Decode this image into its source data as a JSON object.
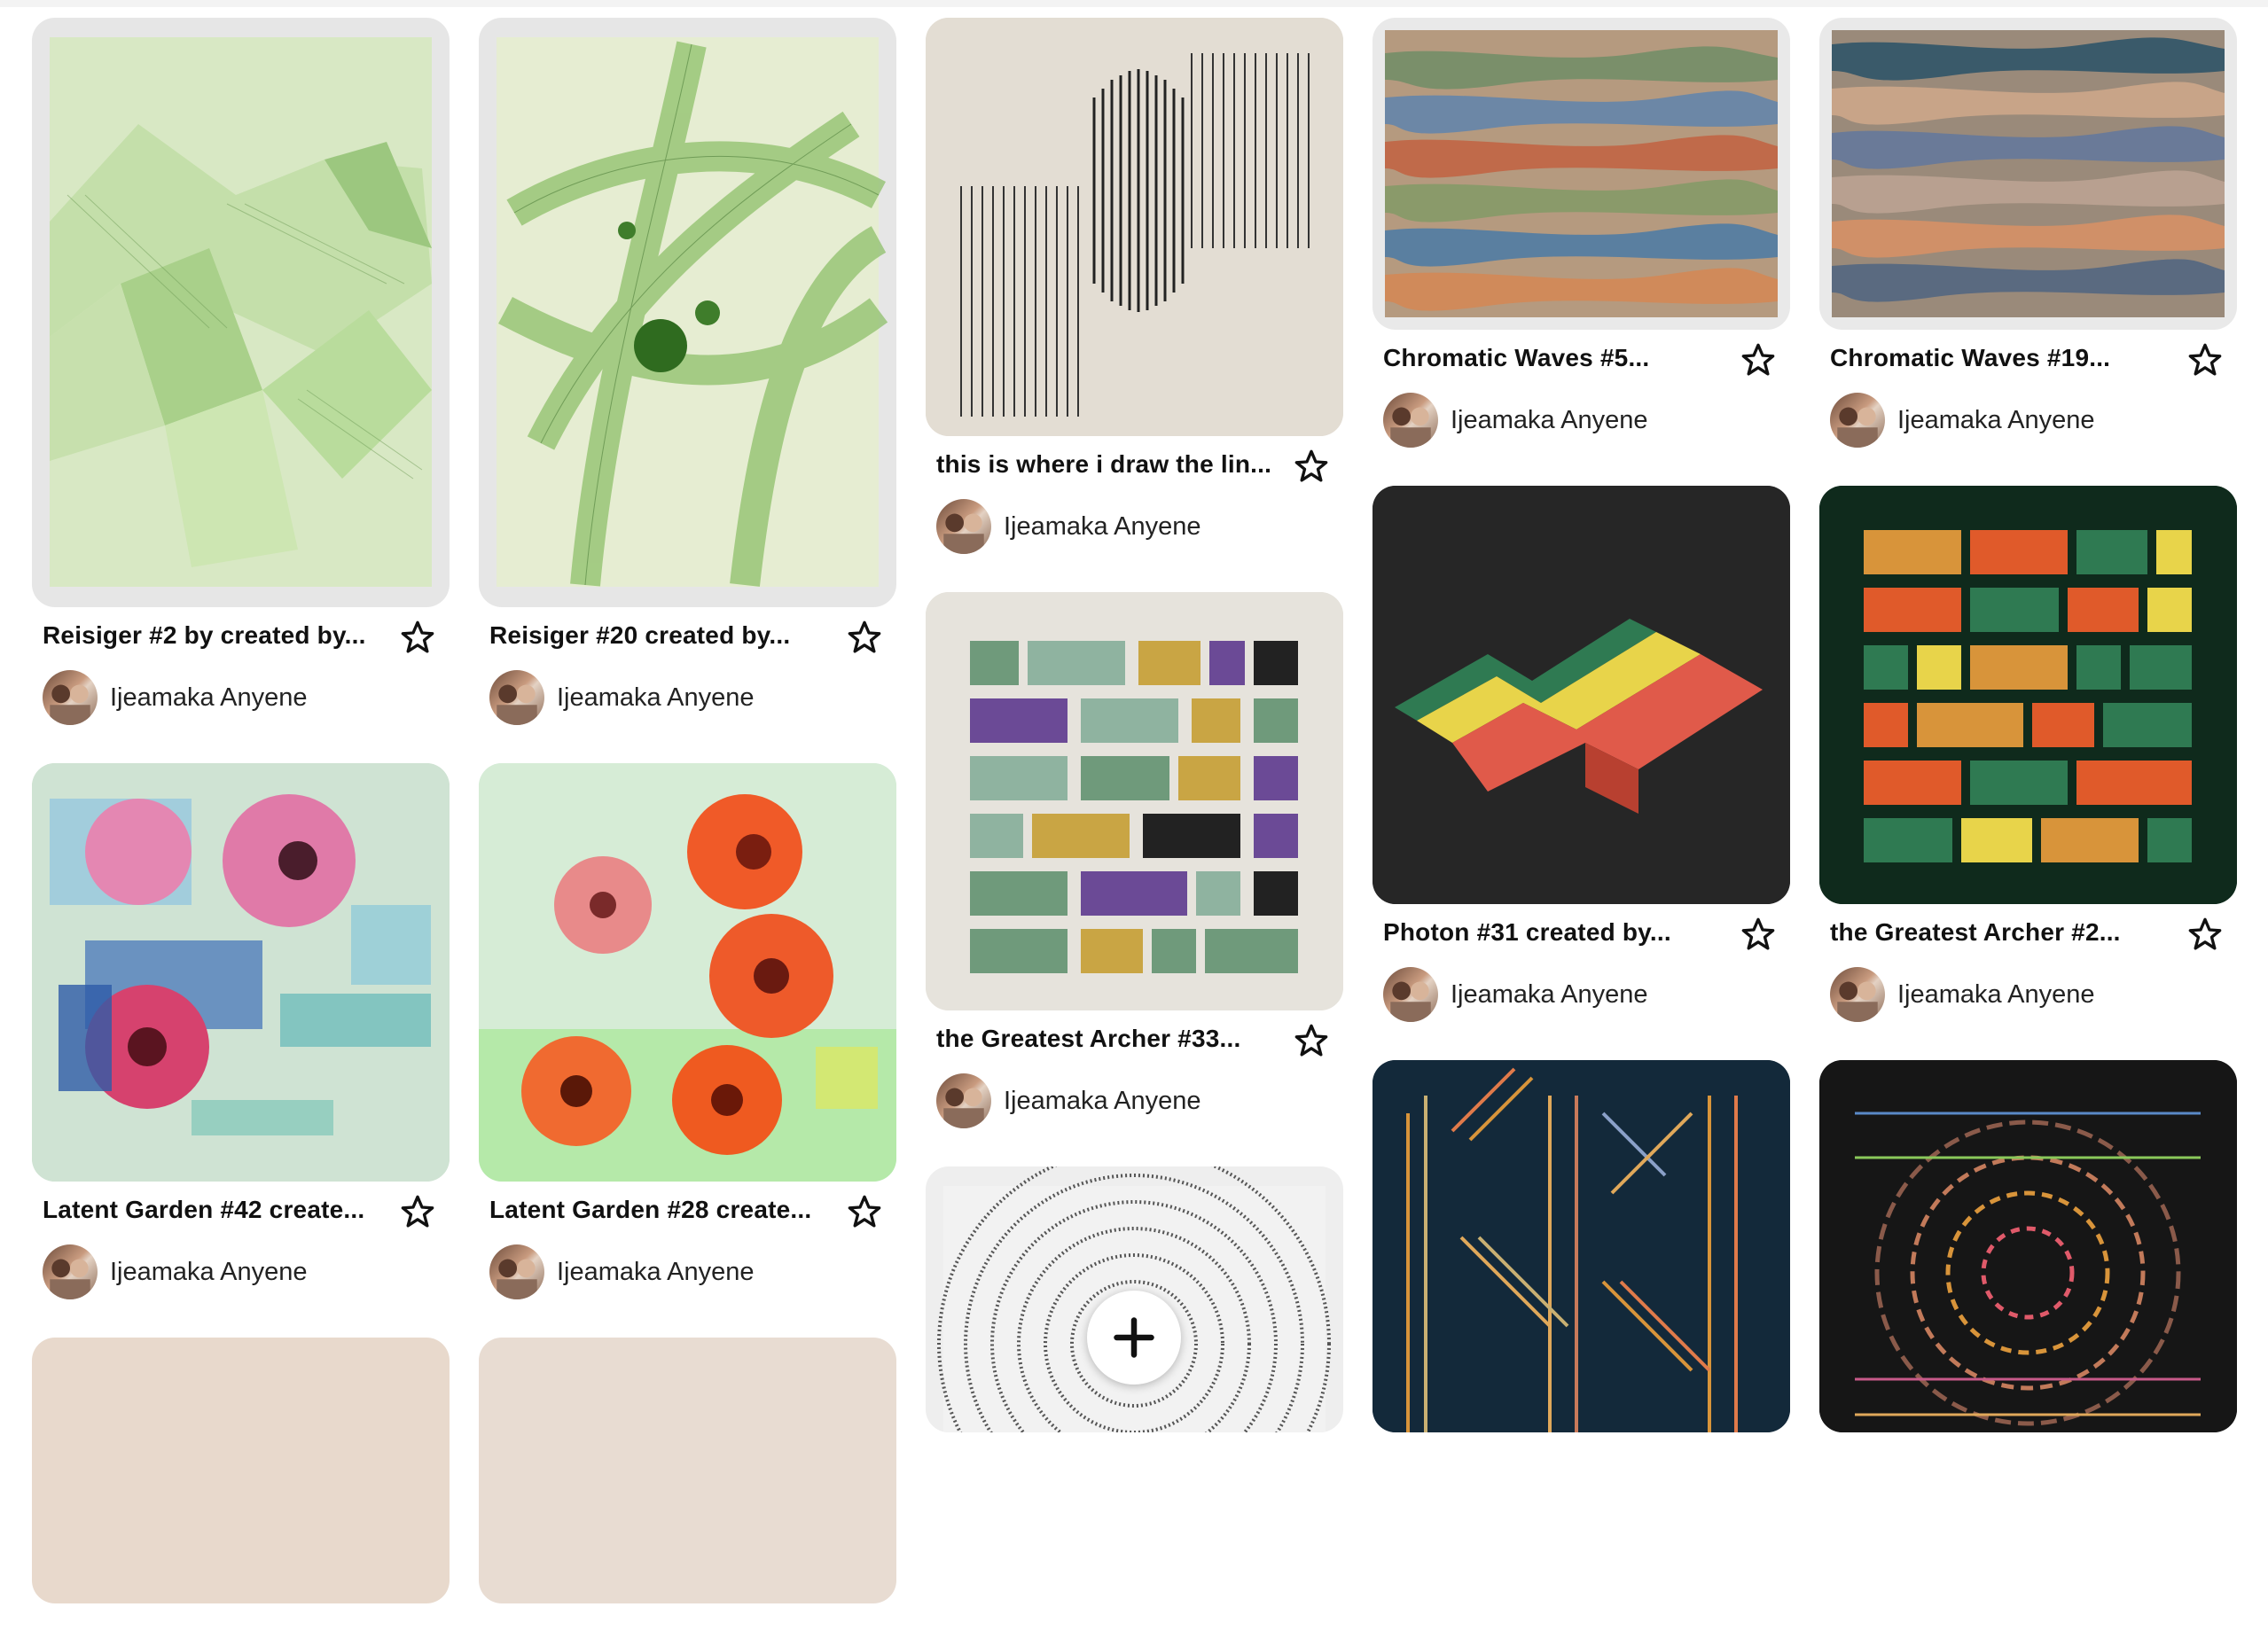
{
  "pins": [
    {
      "title": "Reisiger #2 by created by...",
      "author": "Ijeamaka Anyene"
    },
    {
      "title": "Latent Garden #42 create...",
      "author": "Ijeamaka Anyene"
    },
    {
      "title": "Reisiger #20 created by...",
      "author": "Ijeamaka Anyene"
    },
    {
      "title": "Latent Garden #28 create...",
      "author": "Ijeamaka Anyene"
    },
    {
      "title": "this is where i draw the lin...",
      "author": "Ijeamaka Anyene"
    },
    {
      "title": "the Greatest Archer #33...",
      "author": "Ijeamaka Anyene"
    },
    {
      "title": "Chromatic Waves #5...",
      "author": "Ijeamaka Anyene"
    },
    {
      "title": "Photon #31 created by...",
      "author": "Ijeamaka Anyene"
    },
    {
      "title": "Chromatic Waves #19...",
      "author": "Ijeamaka Anyene"
    },
    {
      "title": "the Greatest Archer #2...",
      "author": "Ijeamaka Anyene"
    }
  ],
  "icons": {
    "save": "star-outline-icon",
    "add": "plus-icon"
  },
  "colors": {
    "text": "#111111",
    "card_bg": "#e9e9e9"
  }
}
